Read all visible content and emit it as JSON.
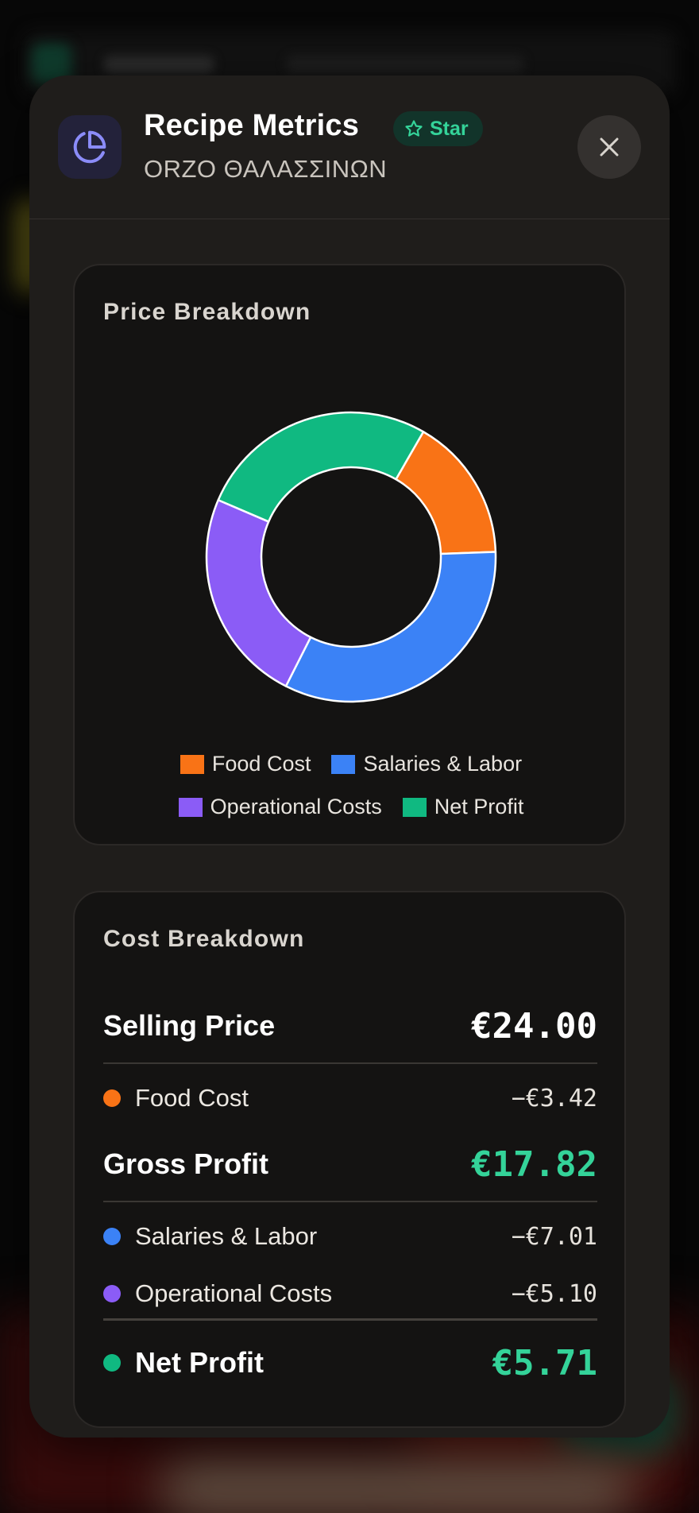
{
  "modal": {
    "title": "Recipe Metrics",
    "star_label": "Star",
    "subtitle": "ORZO ΘΑΛΑΣΣΙΝΩΝ",
    "icon": "pie-chart-icon",
    "close_icon": "close-icon"
  },
  "price_breakdown": {
    "title": "Price Breakdown"
  },
  "chart_data": {
    "type": "pie",
    "title": "Price Breakdown",
    "donut": true,
    "categories": [
      "Food Cost",
      "Salaries & Labor",
      "Operational Costs",
      "Net Profit"
    ],
    "values": [
      3.42,
      7.01,
      5.1,
      5.71
    ],
    "colors": [
      "#f97316",
      "#3b82f6",
      "#8b5cf6",
      "#10b981"
    ],
    "legend_position": "bottom"
  },
  "cost_breakdown": {
    "title": "Cost Breakdown",
    "selling_price": {
      "label": "Selling Price",
      "value": "€24.00"
    },
    "food_cost": {
      "label": "Food Cost",
      "value": "−€3.42"
    },
    "gross_profit": {
      "label": "Gross Profit",
      "value": "€17.82"
    },
    "salaries": {
      "label": "Salaries & Labor",
      "value": "−€7.01"
    },
    "operational": {
      "label": "Operational Costs",
      "value": "−€5.10"
    },
    "net_profit": {
      "label": "Net Profit",
      "value": "€5.71"
    }
  },
  "colors": {
    "accent_green": "#34d399",
    "food": "#f97316",
    "labor": "#3b82f6",
    "operational": "#8b5cf6",
    "profit": "#10b981"
  }
}
